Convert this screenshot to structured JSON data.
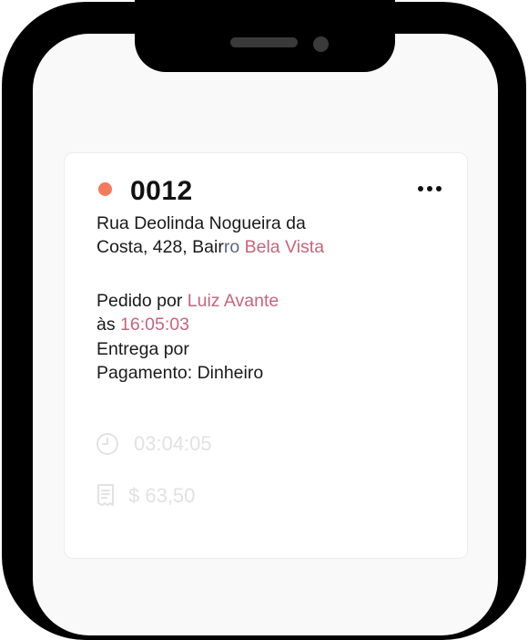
{
  "order": {
    "number": "0012",
    "status_color": "#f47a5e",
    "address_line1": "Rua Deolinda Nogueira da",
    "address_line2_prefix": "Costa, 428, Bair",
    "address_line2_suffix": "ro",
    "neighborhood": "Bela Vista",
    "ordered_by_label": "Pedido por",
    "customer_name": "Luiz Avante",
    "time_prefix": "às",
    "time": "16:05:03",
    "delivery_label": "Entrega por",
    "payment_label": "Pagamento: Dinheiro",
    "elapsed_time": "03:04:05",
    "total": "$ 63,50"
  },
  "icons": {
    "menu": "more-horizontal-icon",
    "clock": "clock-icon",
    "receipt": "receipt-icon"
  },
  "colors": {
    "accent": "#c8657a",
    "status": "#f47a5e"
  }
}
